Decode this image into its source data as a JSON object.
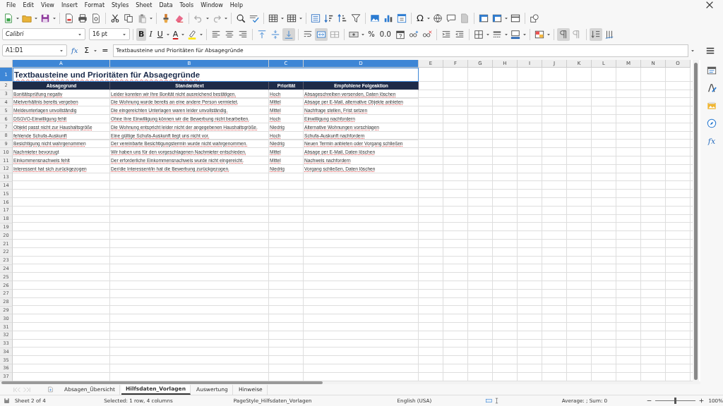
{
  "menu": [
    "File",
    "Edit",
    "View",
    "Insert",
    "Format",
    "Styles",
    "Sheet",
    "Data",
    "Tools",
    "Window",
    "Help"
  ],
  "toolbar": {
    "special_character": "Ω",
    "font_name": "Calibri",
    "font_size": "16 pt",
    "text_styles": [
      {
        "label": "B",
        "on": true
      },
      {
        "label": "I",
        "on": false
      },
      {
        "label": "U",
        "on": false
      }
    ],
    "font_color": "A",
    "number_formats": [
      "%",
      "0.0"
    ],
    "toggles": {
      "align_top": false,
      "align_middle": false,
      "align_bottom": true,
      "wrap_text": false,
      "merge_cells": true,
      "unmerge_cells": false,
      "left_to_right": true,
      "right_to_left": false,
      "stacked_text": true,
      "vertical_text": false
    }
  },
  "formula_bar": {
    "name_box": "A1:D1",
    "function_wizard": "fx",
    "sum": "Σ",
    "equals": "=",
    "content": "Textbausteine und Prioritäten für Absagegründe"
  },
  "columns": [
    {
      "label": "A",
      "selected": true
    },
    {
      "label": "B",
      "selected": true
    },
    {
      "label": "C",
      "selected": true
    },
    {
      "label": "D",
      "selected": true
    },
    {
      "label": "E",
      "selected": false
    },
    {
      "label": "F",
      "selected": false
    },
    {
      "label": "G",
      "selected": false
    },
    {
      "label": "H",
      "selected": false
    },
    {
      "label": "I",
      "selected": false
    },
    {
      "label": "J",
      "selected": false
    },
    {
      "label": "K",
      "selected": false
    },
    {
      "label": "L",
      "selected": false
    },
    {
      "label": "M",
      "selected": false
    },
    {
      "label": "N",
      "selected": false
    },
    {
      "label": "O",
      "selected": false
    }
  ],
  "row_numbers": [
    {
      "label": "1",
      "selected": true
    },
    {
      "label": "2",
      "selected": false
    },
    {
      "label": "3",
      "selected": false
    },
    {
      "label": "4",
      "selected": false
    },
    {
      "label": "5",
      "selected": false
    },
    {
      "label": "6",
      "selected": false
    },
    {
      "label": "7",
      "selected": false
    },
    {
      "label": "8",
      "selected": false
    },
    {
      "label": "9",
      "selected": false
    },
    {
      "label": "10",
      "selected": false
    },
    {
      "label": "11",
      "selected": false
    },
    {
      "label": "12",
      "selected": false
    },
    {
      "label": "13",
      "selected": false
    },
    {
      "label": "14",
      "selected": false
    },
    {
      "label": "15",
      "selected": false
    },
    {
      "label": "16",
      "selected": false
    },
    {
      "label": "17",
      "selected": false
    },
    {
      "label": "18",
      "selected": false
    },
    {
      "label": "19",
      "selected": false
    },
    {
      "label": "20",
      "selected": false
    },
    {
      "label": "21",
      "selected": false
    },
    {
      "label": "22",
      "selected": false
    },
    {
      "label": "23",
      "selected": false
    },
    {
      "label": "24",
      "selected": false
    },
    {
      "label": "25",
      "selected": false
    },
    {
      "label": "26",
      "selected": false
    },
    {
      "label": "27",
      "selected": false
    },
    {
      "label": "28",
      "selected": false
    },
    {
      "label": "29",
      "selected": false
    },
    {
      "label": "30",
      "selected": false
    },
    {
      "label": "31",
      "selected": false
    },
    {
      "label": "32",
      "selected": false
    },
    {
      "label": "33",
      "selected": false
    },
    {
      "label": "34",
      "selected": false
    },
    {
      "label": "35",
      "selected": false
    },
    {
      "label": "36",
      "selected": false
    },
    {
      "label": "37",
      "selected": false
    }
  ],
  "sheet": {
    "title": "Textbausteine und Prioritäten für Absagegründe",
    "header": [
      "Absagegrund",
      "Standardtext",
      "Priorität",
      "Empfohlene Folgeaktion"
    ],
    "rows": [
      [
        "Bonitätsprüfung negativ",
        "Leider konnten wir Ihre Bonität nicht ausreichend bestätigen.",
        "Hoch",
        "Absageschreiben versenden, Daten löschen"
      ],
      [
        "Mietverhältnis bereits vergeben",
        "Die Wohnung wurde bereits an eine andere Person vermietet.",
        "Mittel",
        "Absage per E-Mail, alternative Objekte anbieten"
      ],
      [
        "Meldeunterlagen unvollständig",
        "Die eingereichten Unterlagen waren leider unvollständig.",
        "Mittel",
        "Nachfrage stellen, Frist setzen"
      ],
      [
        "DSGVO-Einwilligung fehlt",
        "Ohne Ihre Einwilligung können wir die Bewerbung nicht bearbeiten.",
        "Hoch",
        "Einwilligung nachfordern"
      ],
      [
        "Objekt passt nicht zur Haushaltsgröße",
        "Die Wohnung entspricht leider nicht der angegebenen Haushaltsgröße.",
        "Niedrig",
        "Alternative Wohnungen vorschlagen"
      ],
      [
        "fehlende Schufa-Auskunft",
        "Eine gültige Schufa-Auskunft liegt uns nicht vor.",
        "Hoch",
        "Schufa-Auskunft nachfordern"
      ],
      [
        "Besichtigung nicht wahrgenommen",
        "Der vereinbarte Besichtigungstermin wurde nicht wahrgenommen.",
        "Niedrig",
        "Neuen Termin anbieten oder Vorgang schließen"
      ],
      [
        "Nachmieter bevorzugt",
        "Wir haben uns für den vorgeschlagenen Nachmieter entschieden.",
        "Mittel",
        "Absage per E-Mail, Daten löschen"
      ],
      [
        "Einkommensnachweis fehlt",
        "Der erforderliche Einkommensnachweis wurde nicht eingereicht.",
        "Mittel",
        "Nachweis nachfordern"
      ],
      [
        "Interessent hat sich zurückgezogen",
        "Der/die Interessent/in hat die Bewerbung zurückgezogen.",
        "Niedrig",
        "Vorgang schließen, Daten löschen"
      ]
    ]
  },
  "tabs": [
    {
      "label": "Absagen_Übersicht",
      "selected": false
    },
    {
      "label": "Hilfsdaten_Vorlagen",
      "selected": true
    },
    {
      "label": "Auswertung",
      "selected": false
    },
    {
      "label": "Hinweise",
      "selected": false
    }
  ],
  "sidebar": {
    "functions": "fx"
  },
  "status_bar": {
    "sheet": "Sheet 2 of 4",
    "selection": "Selected: 1 row, 4 columns",
    "page_style": "PageStyle_Hilfsdaten_Vorlagen",
    "language": "English (USA)",
    "summary": "Average: ; Sum: 0",
    "zoom": {
      "level": 0.5,
      "reading": "100%"
    }
  }
}
